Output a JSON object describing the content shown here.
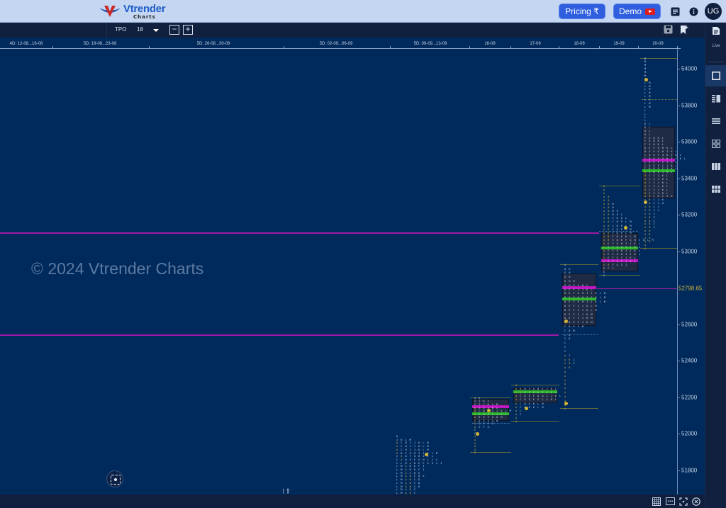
{
  "header": {
    "brand": "Vtrender",
    "brand_sub": "Charts",
    "pricing_label": "Pricing ₹",
    "demo_label": "Demo",
    "icons": [
      "notes-icon",
      "info-icon"
    ],
    "avatar_initials": "UG"
  },
  "toolbar": {
    "chart_type": "TPO",
    "tpo_size": "18",
    "zoom_out": "−",
    "zoom_in": "+",
    "right_icons": [
      "save-icon",
      "bookmark-add-icon"
    ]
  },
  "sidebar": {
    "live_label": "Live",
    "items": [
      {
        "name": "single-layout",
        "active": true
      },
      {
        "name": "split-layout",
        "active": false
      },
      {
        "name": "rows-layout",
        "active": false
      },
      {
        "name": "grid-layout",
        "active": false
      },
      {
        "name": "columns-layout",
        "active": false
      },
      {
        "name": "grid6-layout",
        "active": false
      }
    ]
  },
  "watermark": "© 2024 Vtrender Charts",
  "bottom_icons": [
    "table-icon",
    "abc-icon",
    "fullscreen-icon",
    "close-circle-icon"
  ],
  "chart_data": {
    "type": "tpo_market_profile",
    "title": "",
    "y_axis": {
      "ticks": [
        54000,
        53800,
        53600,
        53400,
        53200,
        53000,
        52600,
        52400,
        52200,
        52000,
        51800
      ],
      "range": [
        51670,
        54150
      ],
      "ltp": "52798.65",
      "ltp_value": 52798.65
    },
    "x_axis": {
      "labels": [
        "4D: 12-08...16-08",
        "5D: 19-08...23-08",
        "5D: 26-08...30-08",
        "5D: 02-09...06-09",
        "5D: 09-09...13-09",
        "16-09",
        "17-09",
        "18-09",
        "19-09",
        "20-09"
      ]
    },
    "reference_lines": [
      {
        "price": 53100,
        "color": "#a11aa6",
        "style": "solid",
        "extent": "to-19-09"
      },
      {
        "price": 52540,
        "color": "#a11aa6",
        "style": "solid",
        "extent": "to-18-09"
      }
    ],
    "profiles": [
      {
        "label": "4D: 12-08...16-08",
        "high": 51700,
        "low": 51680,
        "rows": [
          "L M",
          "L M",
          "L M",
          "L M"
        ]
      },
      {
        "label": "5D: 09-09...13-09",
        "high": 51990,
        "low": 51680,
        "rows": [
          "K",
          "J K L M",
          "A C H I J K L M",
          "A C H I J K L M",
          "A C H I J K L M",
          "A D F G H I J K L M",
          "C A D F G H I J L",
          "C A D E F G H I J L",
          "C L M A D E F G H I J",
          "L M A D E F I",
          "L M A D E F I",
          "L M A C D E",
          "L M A B C D E",
          "L M A B C D",
          "L M A B C D",
          "L M A B C D",
          "L M A B C",
          "L M A B C"
        ]
      },
      {
        "label": "16-09",
        "high": 52200,
        "low": 51900,
        "va_high": 52190,
        "va_low": 52070,
        "poc": 52110,
        "vpoc": 52150,
        "rows": [
          "J K",
          "I J K L",
          "C I J K L M",
          "B E I J K L",
          "B C D H I J K L M",
          "A C D H I J K L",
          "A D E F G H M",
          "A D E F G H",
          "A D E F G",
          "A E F G",
          "C",
          "C",
          "A",
          "A",
          "A",
          "A",
          "A",
          "A"
        ]
      },
      {
        "label": "17-09",
        "high": 52270,
        "low": 52070,
        "va_high": 52250,
        "va_low": 52170,
        "poc": 52230,
        "rows": [
          "A",
          "A B D F G H I J K L",
          "A B E F G H I J K L",
          "A C D E F G H I J K L",
          "A C D E F G I J K L",
          "A C D E K L M",
          "A C D E K L M",
          "A C",
          "A C",
          "A",
          "A"
        ]
      },
      {
        "label": "18-09",
        "high": 52930,
        "low": 52140,
        "va_high": 52880,
        "va_low": 52590,
        "poc": 52740,
        "vpoc": 52800,
        "rows": [
          "G",
          "G H",
          "G H",
          "G H",
          "G H R",
          "G H I J K L",
          "D E F I J K L",
          "D E F G H I J K L M",
          "D E F G H I J K L M",
          "D E F G H I J K L M",
          "D E F I J K L M",
          "D E F I J K L M",
          "D E F I J K M",
          "D E F I J K M",
          "C D E I J K M",
          "C D E I M",
          "C D M",
          "C D",
          "C D",
          "C",
          "C",
          "C",
          "A C",
          "A B C",
          "A B C",
          "A B",
          "A",
          "A",
          "A",
          "A",
          "A",
          "A",
          "A",
          "A",
          "A",
          "A"
        ]
      },
      {
        "label": "19-09",
        "high": 53360,
        "low": 52870,
        "va_high": 53100,
        "va_low": 52890,
        "poc": 53020,
        "vpoc": 52950,
        "rows": [
          "A",
          "A",
          "A",
          "A B",
          "A B",
          "A B D",
          "A B D",
          "A B D E",
          "A B D E L",
          "A B C D E L",
          "A B C D E L M",
          "A B C D E L M",
          "A B C D E L M",
          "A B C D E L M",
          "A B C D E K L M",
          "A B C D E F G H I K L M",
          "A E F G H I J K L",
          "A E F G H I J K L",
          "A E F G H I J K L",
          "A E F G H I J K L",
          "A E F G I J K L",
          "A E F G I J K L",
          "A B F G I J",
          "E F J",
          "E",
          "E"
        ]
      },
      {
        "label": "20-09",
        "high": 54060,
        "low": 53020,
        "va_high": 53680,
        "va_low": 53290,
        "poc": 53440,
        "vpoc": 53500,
        "rows": [
          "M",
          "M",
          "M",
          "M",
          "M",
          "M",
          "M",
          "L M",
          "L M",
          "L M",
          "L M",
          "L M",
          "L M",
          "L M",
          "L M",
          "L",
          "L",
          "L",
          "L",
          "K L",
          "K L",
          "K L",
          "K L",
          "F G H K L",
          "F G H K L",
          "F G H K L",
          "D E F G H K L",
          "D E F G H I K L",
          "C D E F G H I K L",
          "C D E F G H I J K L",
          "C D E F I J K L",
          "C D E F I J K L",
          "C D E F I J K L",
          "B C D I J K L",
          "B C I J K L",
          "B C I J K L",
          "B C I J K L",
          "B C I J K L",
          "B C I J K L",
          "B C I J K L",
          "A B C D I J K",
          "A B I J K",
          "A B I J K",
          "A B I J",
          "A B I J",
          "A B I",
          "A B I",
          "A B I",
          "A B I",
          "A B I",
          "A B",
          "A B",
          "A B",
          "A B",
          "A",
          "A"
        ]
      }
    ]
  }
}
